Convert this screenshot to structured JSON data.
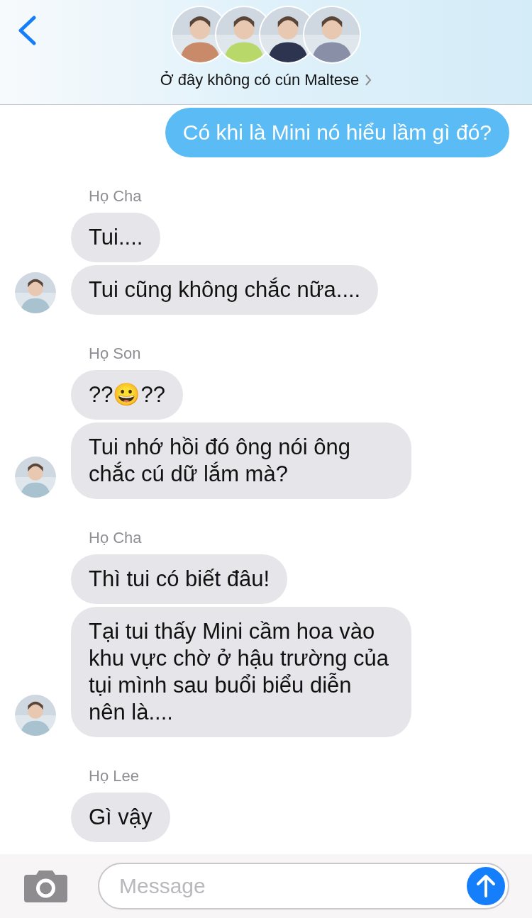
{
  "header": {
    "title": "Ở đây không có cún Maltese"
  },
  "messages": [
    {
      "kind": "outgoing",
      "bubbles": [
        "Có khi là Mini nó hiểu lầm gì đó?"
      ]
    },
    {
      "kind": "incoming",
      "sender": "Họ Cha",
      "bubbles": [
        "Tui....",
        "Tui cũng không chắc nữa...."
      ]
    },
    {
      "kind": "incoming",
      "sender": "Họ Son",
      "bubbles": [
        "??😀??",
        "Tui nhớ hồi đó ông nói ông chắc cú dữ lắm mà?"
      ]
    },
    {
      "kind": "incoming",
      "sender": "Họ Cha",
      "bubbles": [
        "Thì tui có biết đâu!",
        "Tại tui thấy Mini cầm hoa vào khu vực chờ ở hậu trường của tụi mình sau buổi biểu diễn nên là...."
      ]
    },
    {
      "kind": "incoming",
      "sender": "Họ Lee",
      "bubbles": [
        "Gì vậy"
      ]
    }
  ],
  "composer": {
    "placeholder": "Message"
  }
}
